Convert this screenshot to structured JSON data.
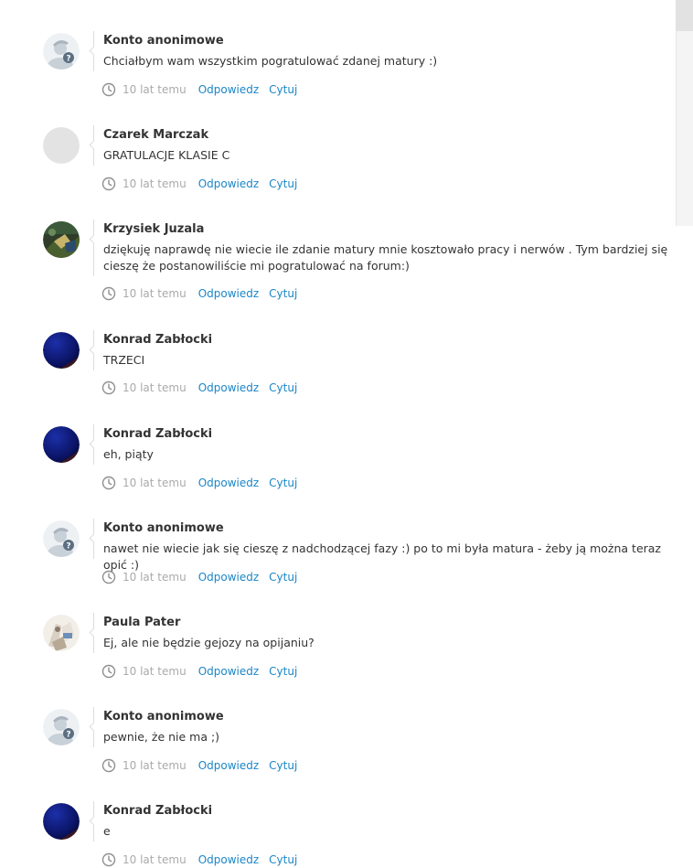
{
  "comments": [
    {
      "author": "Konto anonimowe",
      "avatar": "anonymous-avatar",
      "text": "Chciałbym wam wszystkim pogratulować zdanej matury :)",
      "time": "10 lat temu",
      "reply": "Odpowiedz",
      "quote": "Cytuj"
    },
    {
      "author": "Czarek Marczak",
      "avatar": "blank-avatar",
      "text": "GRATULACJE KLASIE C",
      "time": "10 lat temu",
      "reply": "Odpowiedz",
      "quote": "Cytuj"
    },
    {
      "author": "Krzysiek Juzala",
      "avatar": "photo-avatar",
      "text": "dziękuję naprawdę nie wiecie ile zdanie matury mnie kosztowało pracy i nerwów . Tym bardziej się cieszę że postanowiliście mi pogratulować na forum:)",
      "time": "10 lat temu",
      "reply": "Odpowiedz",
      "quote": "Cytuj"
    },
    {
      "author": "Konrad Zabłocki",
      "avatar": "night-sky-avatar",
      "text": "TRZECI",
      "time": "10 lat temu",
      "reply": "Odpowiedz",
      "quote": "Cytuj"
    },
    {
      "author": "Konrad Zabłocki",
      "avatar": "night-sky-avatar",
      "text": "eh, piąty",
      "time": "10 lat temu",
      "reply": "Odpowiedz",
      "quote": "Cytuj"
    },
    {
      "author": "Konto anonimowe",
      "avatar": "anonymous-avatar",
      "text": "nawet nie wiecie jak się cieszę z nadchodzącej fazy :) po to mi była matura - żeby ją można teraz opić :)",
      "time": "10 lat temu",
      "reply": "Odpowiedz",
      "quote": "Cytuj"
    },
    {
      "author": "Paula Pater",
      "avatar": "photo-avatar-light",
      "text": "Ej, ale nie będzie gejozy na opijaniu?",
      "time": "10 lat temu",
      "reply": "Odpowiedz",
      "quote": "Cytuj"
    },
    {
      "author": "Konto anonimowe",
      "avatar": "anonymous-avatar",
      "text": "pewnie, że nie ma ;)",
      "time": "10 lat temu",
      "reply": "Odpowiedz",
      "quote": "Cytuj"
    },
    {
      "author": "Konrad Zabłocki",
      "avatar": "night-sky-avatar",
      "text": "e",
      "time": "10 lat temu",
      "reply": "Odpowiedz",
      "quote": "Cytuj"
    }
  ],
  "colors": {
    "link": "#1b86c7",
    "muted": "#aaaaaa",
    "text": "#333333"
  },
  "icons": {
    "time": "clock-icon"
  }
}
